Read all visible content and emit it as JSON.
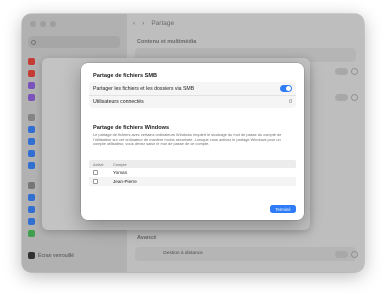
{
  "window": {
    "nav_back_icon": "chevron-left-icon",
    "nav_forward_icon": "chevron-right-icon",
    "pane_title": "Partage",
    "section_content": "Contenu et multimédia",
    "section_advanced": "Avancé",
    "remote_mgmt_label": "Gestion à distance",
    "remote_label": "Gestion à distance",
    "lock_label": "Écran verrouillé"
  },
  "sheet": {
    "title": "Partage de fichiers SMB",
    "share_toggle_label": "Partager les fichiers et les dossiers via SMB",
    "share_toggle_on": true,
    "connected_users_label": "Utilisateurs connectés",
    "connected_users_count": "0",
    "windows_title": "Partage de fichiers Windows",
    "windows_desc": "Le partage de fichiers avec certains ordinateurs Windows requiert le stockage du mot de passe du compte de l’utilisateur sur cet ordinateur de manière moins sécurisée. Lorsque vous activez le partage Windows pour un compte utilisateur, vous devez saisir le mot de passe de ce compte.",
    "table": {
      "col_active": "Activé",
      "col_account": "Compte",
      "rows": [
        {
          "account": "Yoman",
          "checked": false
        },
        {
          "account": "Jean-Pierre",
          "checked": false
        }
      ]
    },
    "done_label": "Terminé"
  },
  "colors": {
    "accent": "#2f7cf6"
  }
}
